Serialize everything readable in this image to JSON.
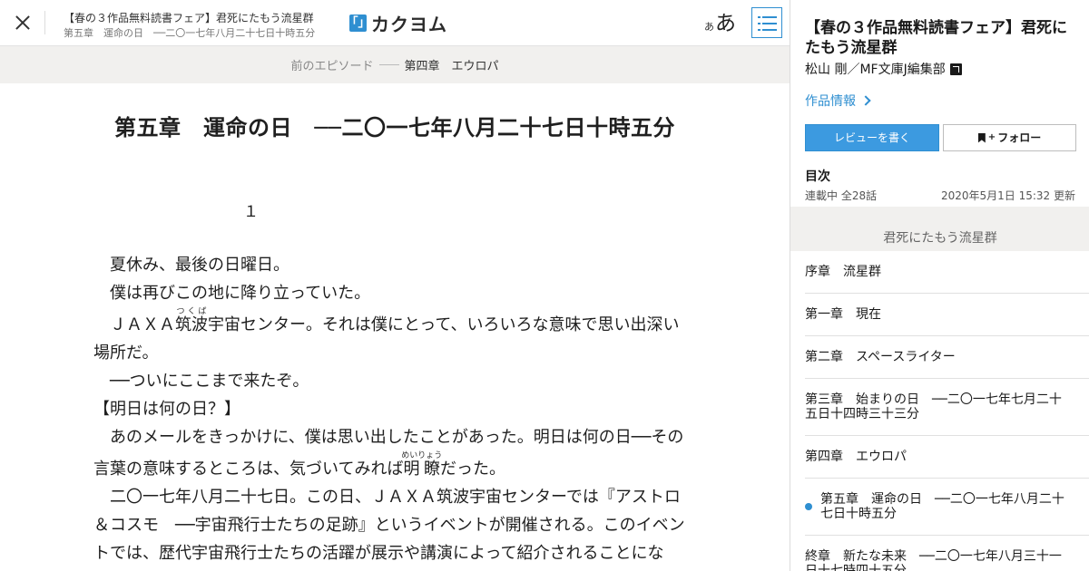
{
  "topbar": {
    "work_title": "【春の３作品無料読書フェア】君死にたもう流星群",
    "episode_title": "第五章　運命の日　──二〇一七年八月二十七日十時五分",
    "logo_mark": "「」",
    "logo_text": "カクヨム",
    "font_small": "あ",
    "font_big": "あ",
    "close_icon": "close-icon",
    "toc_icon": "list-icon"
  },
  "episode_nav": {
    "prev_label": "前のエピソード",
    "chapter": "第四章　エウロパ"
  },
  "episode": {
    "heading": "第五章　運命の日　──二〇一七年八月二十七日十時五分",
    "section": "１",
    "lines": [
      "　夏休み、最後の日曜日。",
      "　僕は再びこの地に降り立っていた。",
      "　ＪＡＸＡ筑波宇宙センター。それは僕にとって、いろいろな意味で思い出深い",
      "場所だ。",
      "　──ついにここまで来たぞ。",
      "【明日は何の日？】",
      "　あのメールをきっかけに、僕は思い出したことがあった。明日は何の日──その",
      "言葉の意味するところは、気づいてみれば明瞭だった。",
      "　二〇一七年八月二十七日。この日、ＪＡＸＡ筑波宇宙センターでは『アストロ",
      "＆コスモ　──宇宙飛行士たちの足跡』というイベントが開催される。このイベン",
      "トでは、歴代宇宙飛行士たちの活躍が展示や講演によって紹介されることにな"
    ],
    "rubies": {
      "tsukuba_base": "筑波",
      "tsukuba_rt": "つくば",
      "meiryo_base": "明瞭",
      "meiryo_rt": "めいりょう"
    }
  },
  "sidebar": {
    "work_title": "【春の３作品無料読書フェア】君死にたもう流星群",
    "author": "松山 剛／MF文庫J編集部",
    "work_info": "作品情報",
    "review_button": "レビューを書く",
    "follow_button": "フォロー",
    "toc_label": "目次",
    "status": "連載中 全28話",
    "updated": "2020年5月1日 15:32 更新",
    "toc_header": "君死にたもう流星群",
    "chapters": [
      "序章　流星群",
      "第一章　現在",
      "第二章　スペースライター",
      "第三章　始まりの日　──二〇一七年七月二十五日十四時三十三分",
      "第四章　エウロパ",
      "第五章　運命の日　──二〇一七年八月二十七日十時五分",
      "終章　新たな未来　──二〇一七年八月三十一日十七時四十五分"
    ],
    "current_chapter_index": 5
  },
  "colors": {
    "accent": "#2f8fd1",
    "nav_bg": "#f1f0ee"
  }
}
